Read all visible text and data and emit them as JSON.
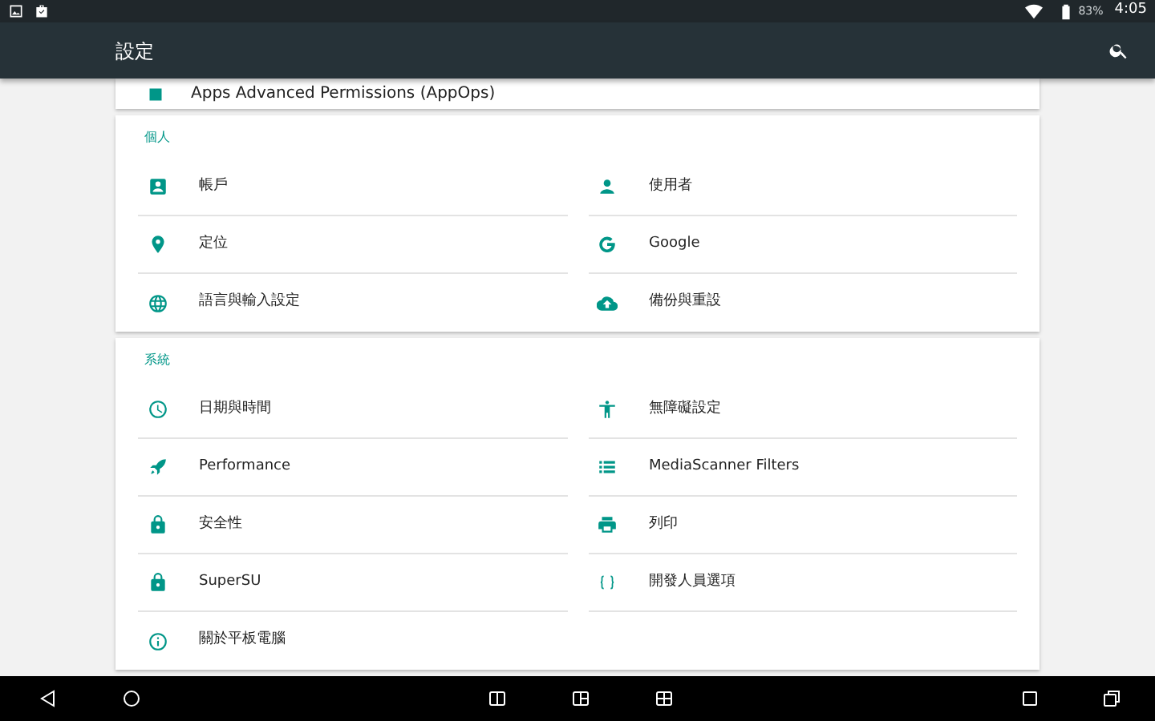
{
  "status_bar": {
    "battery": "83%",
    "time": "4:05"
  },
  "app_bar": {
    "title": "設定"
  },
  "partial_item": {
    "label": "Apps Advanced Permissions (AppOps)"
  },
  "sections": [
    {
      "header": "個人",
      "items": [
        {
          "label": "帳戶"
        },
        {
          "label": "使用者"
        },
        {
          "label": "定位"
        },
        {
          "label": "Google"
        },
        {
          "label": "語言與輸入設定"
        },
        {
          "label": "備份與重設"
        }
      ]
    },
    {
      "header": "系統",
      "items": [
        {
          "label": "日期與時間"
        },
        {
          "label": "無障礙設定"
        },
        {
          "label": "Performance"
        },
        {
          "label": "MediaScanner Filters"
        },
        {
          "label": "安全性"
        },
        {
          "label": "列印"
        },
        {
          "label": "SuperSU"
        },
        {
          "label": "開發人員選項"
        },
        {
          "label": "關於平板電腦"
        }
      ]
    }
  ]
}
